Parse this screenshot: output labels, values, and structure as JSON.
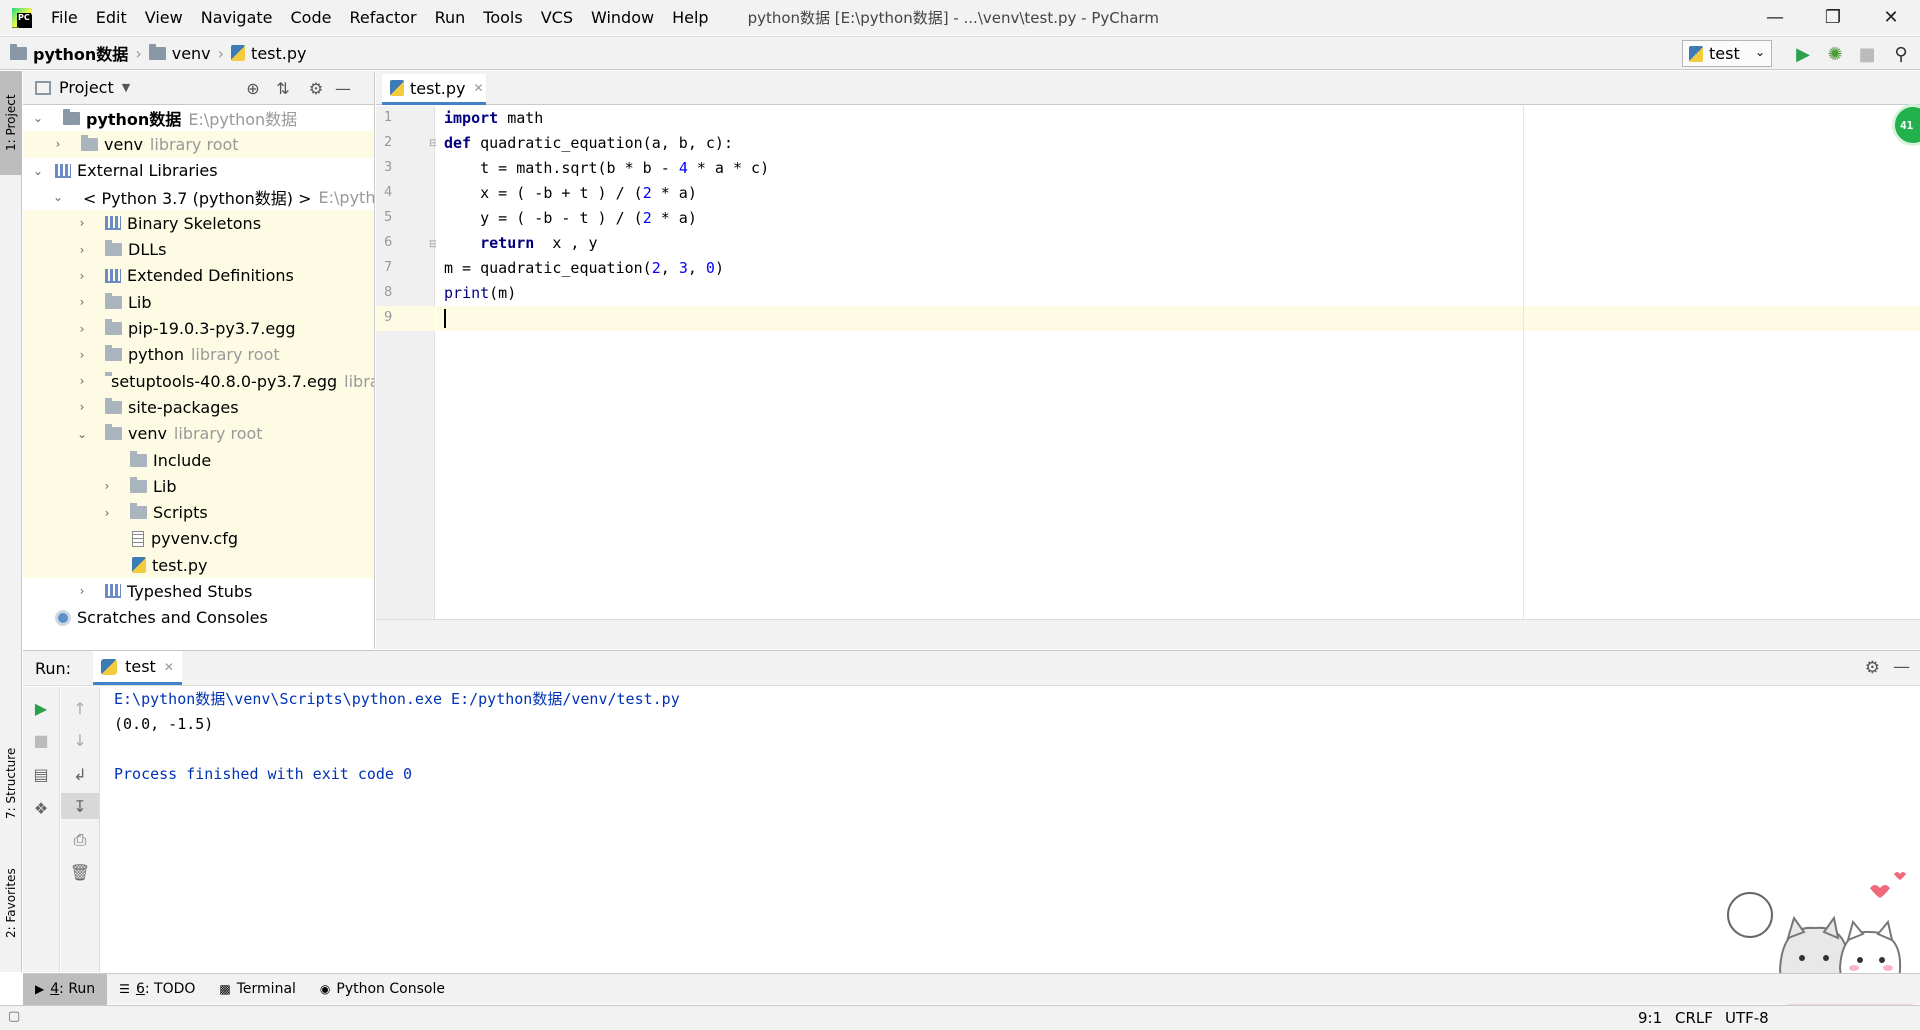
{
  "titlebar": {
    "menu": [
      "File",
      "Edit",
      "View",
      "Navigate",
      "Code",
      "Refactor",
      "Run",
      "Tools",
      "VCS",
      "Window",
      "Help"
    ],
    "window_title": "python数据 [E:\\python数据] - ...\\venv\\test.py - PyCharm",
    "logo_text": "PC"
  },
  "navbar": {
    "breadcrumb": [
      "python数据",
      "venv",
      "test.py"
    ],
    "run_config": "test"
  },
  "left_stripe": {
    "project": "1: Project",
    "structure": "7: Structure",
    "favorites": "2: Favorites"
  },
  "project": {
    "title": "Project",
    "tree": [
      {
        "label": "python数据",
        "hint": "E:\\python数据"
      },
      {
        "label": "venv",
        "hint": "library root"
      },
      {
        "label": "External Libraries"
      },
      {
        "label": "< Python 3.7 (python数据) >",
        "hint": "E:\\pytho"
      },
      {
        "label": "Binary Skeletons"
      },
      {
        "label": "DLLs"
      },
      {
        "label": "Extended Definitions"
      },
      {
        "label": "Lib"
      },
      {
        "label": "pip-19.0.3-py3.7.egg"
      },
      {
        "label": "python",
        "hint": "library root"
      },
      {
        "label": "setuptools-40.8.0-py3.7.egg",
        "hint": "librar"
      },
      {
        "label": "site-packages"
      },
      {
        "label": "venv",
        "hint": "library root"
      },
      {
        "label": "Include"
      },
      {
        "label": "Lib"
      },
      {
        "label": "Scripts"
      },
      {
        "label": "pyvenv.cfg"
      },
      {
        "label": "test.py"
      },
      {
        "label": "Typeshed Stubs"
      },
      {
        "label": "Scratches and Consoles"
      }
    ]
  },
  "editor": {
    "tab": "test.py",
    "line_numbers": [
      "1",
      "2",
      "3",
      "4",
      "5",
      "6",
      "7",
      "8",
      "9"
    ],
    "inspection_badge": "41",
    "code": {
      "l1_kw": "import",
      "l1_rest": " math",
      "l2_kw": "def",
      "l2_rest": " quadratic_equation(a, b, c):",
      "l3_a": "    t = math.sqrt(b * b - ",
      "l3_n1": "4",
      "l3_b": " * a * c)",
      "l4_a": "    x = ( -b + t ) / (",
      "l4_n1": "2",
      "l4_b": " * a)",
      "l5_a": "    y = ( -b - t ) / (",
      "l5_n1": "2",
      "l5_b": " * a)",
      "l6_kw": "    return",
      "l6_rest": "  x , y",
      "l7_a": "m = quadratic_equation(",
      "l7_n1": "2",
      "l7_c1": ", ",
      "l7_n2": "3",
      "l7_c2": ", ",
      "l7_n3": "0",
      "l7_b": ")",
      "l8_fn": "print",
      "l8_rest": "(m)"
    }
  },
  "run": {
    "label": "Run:",
    "tab": "test",
    "console": [
      "E:\\python数据\\venv\\Scripts\\python.exe E:/python数据/venv/test.py",
      "(0.0, -1.5)",
      "",
      "Process finished with exit code 0"
    ]
  },
  "bottom_tabs": [
    {
      "num": "4",
      "label": ": Run"
    },
    {
      "num": "6",
      "label": ": TODO"
    },
    {
      "label": "Terminal"
    },
    {
      "label": "Python Console"
    }
  ],
  "status": {
    "position": "9:1",
    "line_sep": "CRLF",
    "encoding": "UTF-8"
  }
}
